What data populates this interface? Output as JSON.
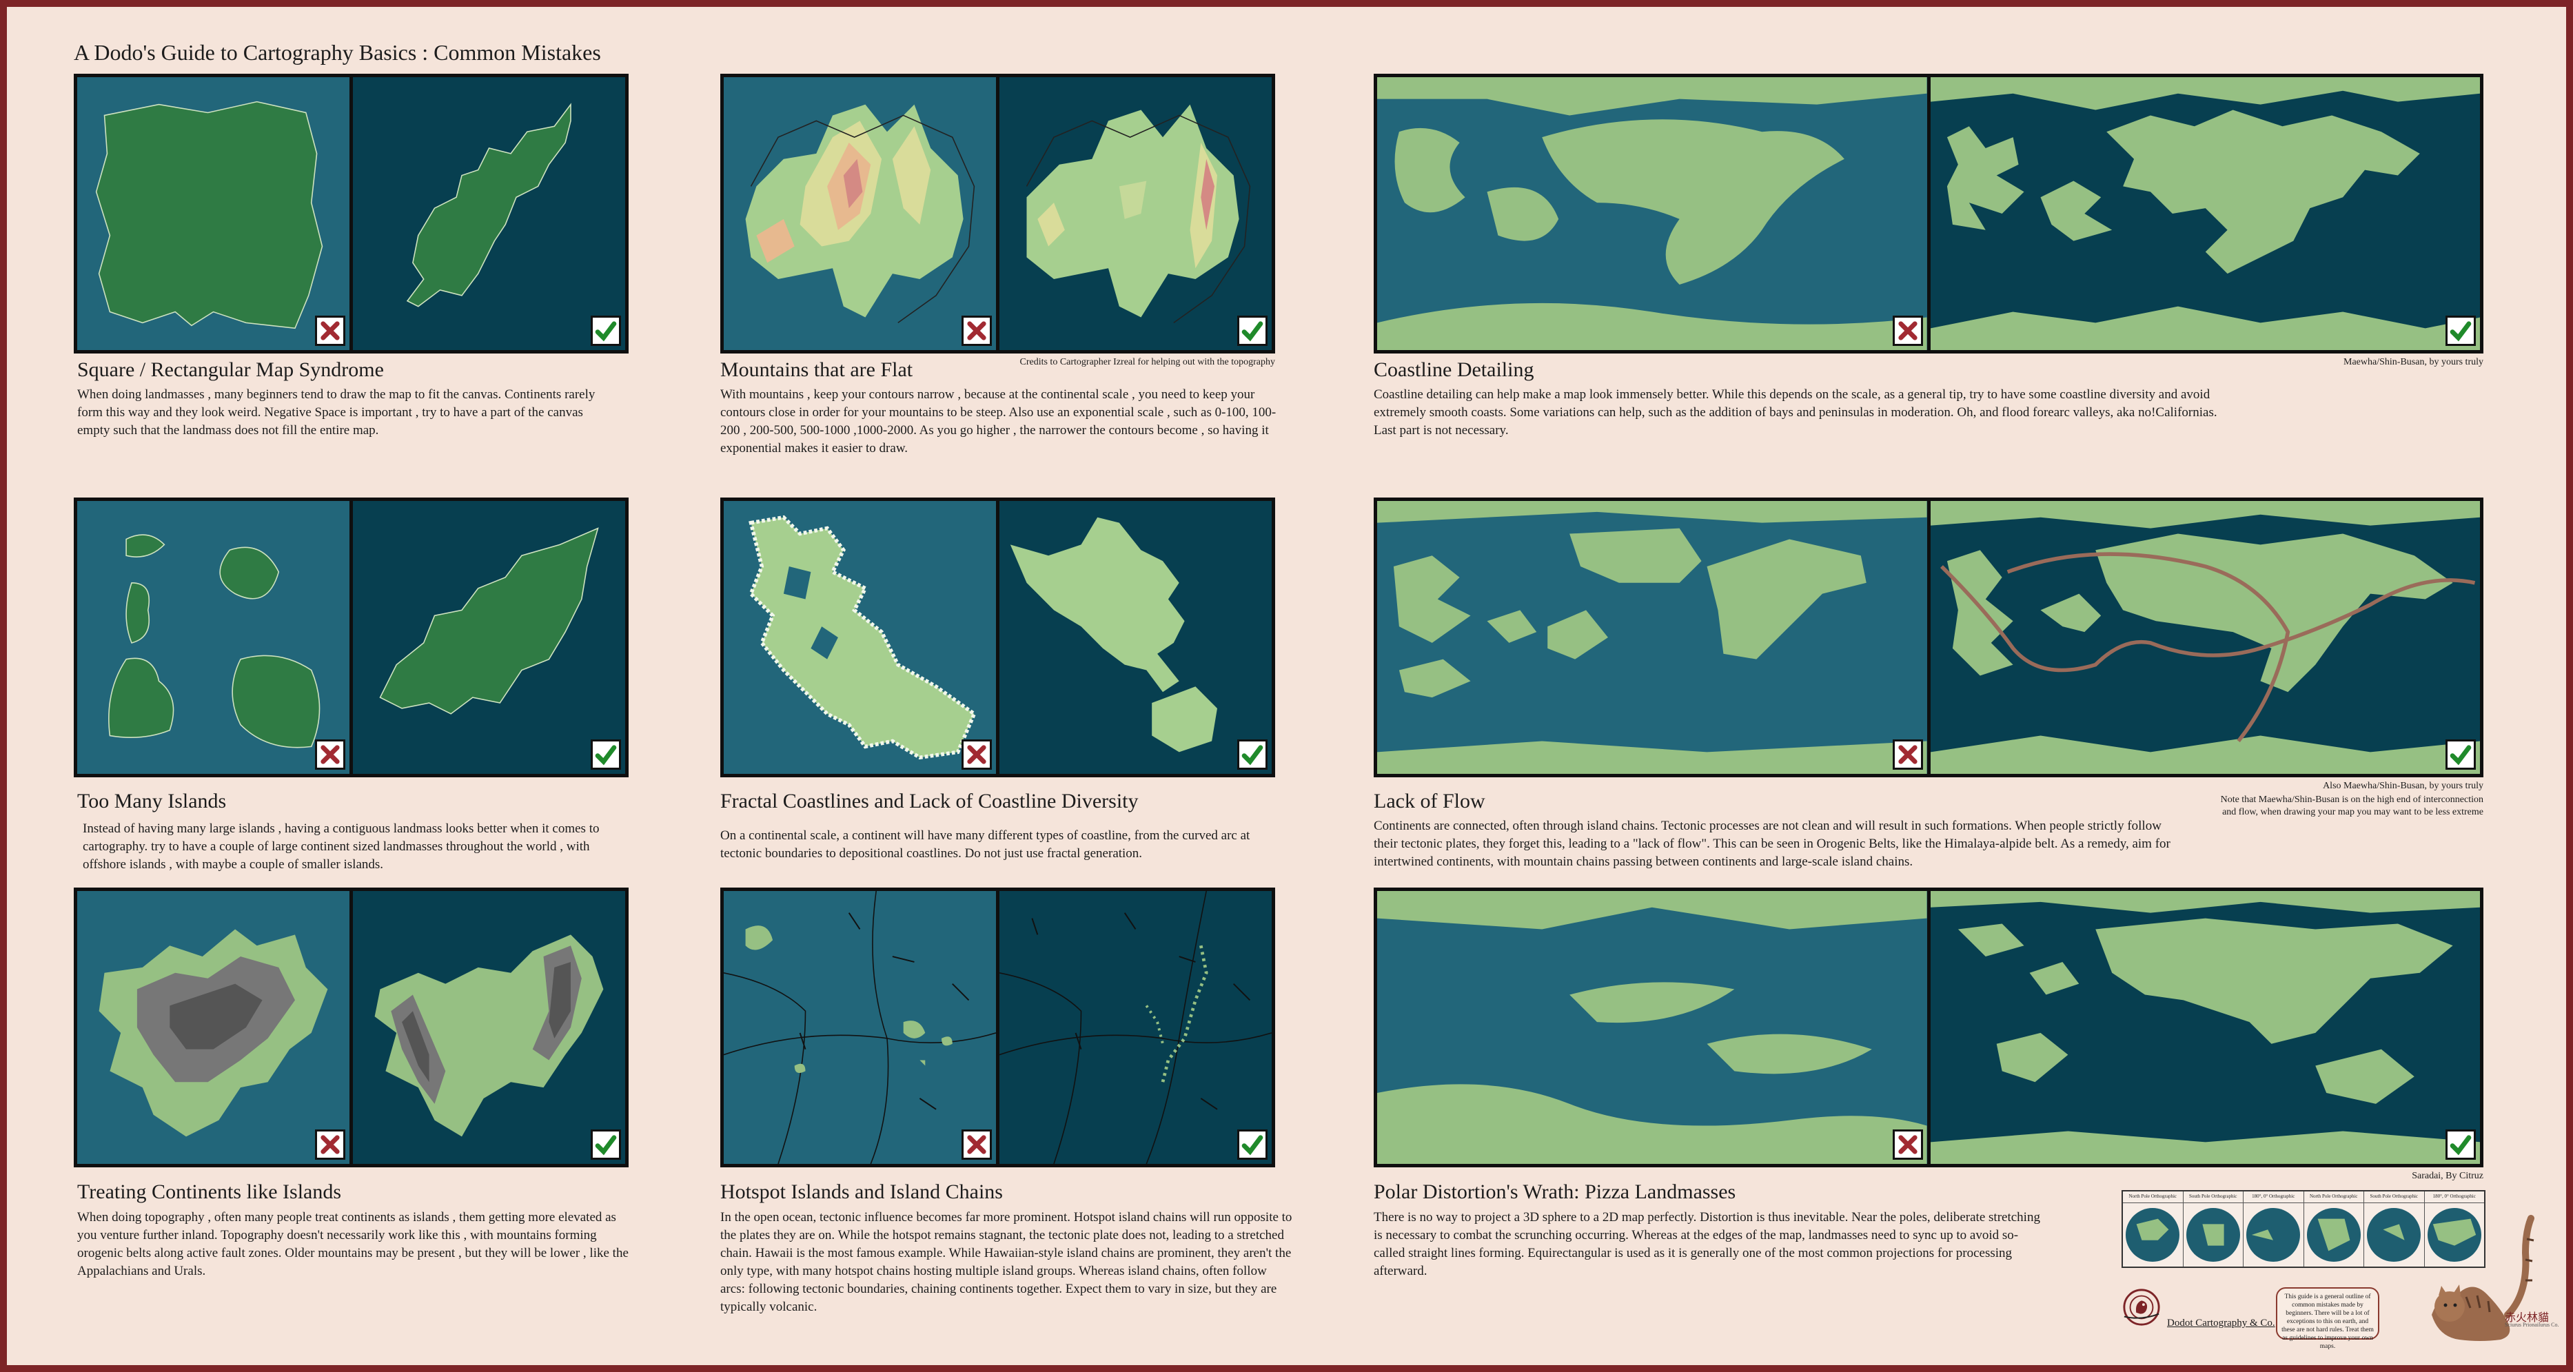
{
  "page_title": "A Dodo's Guide to Cartography Basics : Common Mistakes",
  "colors": {
    "background": "#f5e4da",
    "border": "#7d2427",
    "ocean_light": "#22667a",
    "ocean_dark": "#073f50",
    "land_dark": "#2f7b44",
    "land_light": "#96c083",
    "cross": "#a12a32",
    "check": "#1f8a2a"
  },
  "sections": [
    {
      "title": "Square / Rectangular Map Syndrome",
      "body": "When doing landmasses , many beginners tend to draw the map to fit the canvas. Continents rarely form this way and they look weird. Negative Space is important , try to have a part of the canvas empty such that the landmass does not fill the entire map.",
      "bad_icon": "cross-icon",
      "good_icon": "check-icon"
    },
    {
      "title": "Mountains that are Flat",
      "credit": "Credits to Cartographer Izreal for helping out with the topography",
      "body": "With mountains , keep your contours narrow , because at the continental scale , you need to keep your contours close in order for your mountains to be steep. Also use an exponential scale , such as 0-100, 100-200 , 200-500, 500-1000 ,1000-2000. As you go higher , the narrower the contours become , so having it exponential makes it easier to draw.",
      "bad_icon": "cross-icon",
      "good_icon": "check-icon"
    },
    {
      "title": "Coastline Detailing",
      "credit": "Maewha/Shin-Busan, by yours truly",
      "body": "Coastline detailing can help make a map look immensely better. While this depends on the scale, as a general tip, try to have some coastline diversity and avoid extremely smooth coasts. Some variations can help, such as the addition of bays and peninsulas in moderation. Oh, and flood forearc valleys, aka no!Californias. Last part is not necessary.",
      "bad_icon": "cross-icon",
      "good_icon": "check-icon"
    },
    {
      "title": "Too Many Islands",
      "body": "Instead of having many large islands , having a contiguous landmass looks better when it comes to cartography. try to have a couple of large continent sized landmasses throughout the world , with offshore islands , with maybe a couple of smaller islands.",
      "bad_icon": "cross-icon",
      "good_icon": "check-icon"
    },
    {
      "title": "Fractal Coastlines and Lack of Coastline Diversity",
      "body": "On a continental scale, a continent will have many different types of coastline, from the curved arc at tectonic boundaries to depositional coastlines. Do not just use fractal generation.",
      "bad_icon": "cross-icon",
      "good_icon": "check-icon"
    },
    {
      "title": "Lack of Flow",
      "credit": "Also Maewha/Shin-Busan, by yours truly",
      "credit2": "Note that Maewha/Shin-Busan is on the high end of interconnection and flow, when drawing your map you may want to be less extreme",
      "body": "Continents are connected, often through island chains. Tectonic processes are not clean and will result in such formations. When people strictly follow their tectonic plates, they forget this, leading to a \"lack of flow\". This can be seen in Orogenic Belts, like the Himalaya-alpide belt. As a remedy, aim for intertwined continents, with mountain chains passing between continents and large-scale island chains.",
      "bad_icon": "cross-icon",
      "good_icon": "check-icon"
    },
    {
      "title": "Treating Continents like Islands",
      "body": "When doing topography , often many people treat continents as islands , them getting more elevated as you venture further inland. Topography doesn't necessarily work like this , with mountains forming orogenic belts along active fault zones. Older mountains may be present , but they will be lower , like the Appalachians and Urals.",
      "bad_icon": "cross-icon",
      "good_icon": "check-icon"
    },
    {
      "title": "Hotspot Islands and Island Chains",
      "body": "In the open ocean, tectonic influence becomes far more prominent. Hotspot island chains will run opposite to the plates they are on. While the hotspot remains stagnant, the tectonic plate does not, leading to a stretched chain. Hawaii is the most famous example. While Hawaiian-style island chains are prominent, they aren't the only type, with many hotspot chains hosting multiple island groups. Whereas island chains, often follow arcs: following tectonic boundaries, chaining continents together. Expect them to vary in size, but they are typically volcanic.",
      "bad_icon": "cross-icon",
      "good_icon": "check-icon"
    },
    {
      "title": "Polar Distortion's Wrath: Pizza Landmasses",
      "credit": "Saradai, By Citruz",
      "body": "There is no way to project a 3D sphere to a 2D map perfectly. Distortion is thus inevitable. Near the poles, deliberate stretching is necessary to combat the scrunching occurring. Whereas at the edges of the map, landmasses need to sync up to avoid so-called straight lines forming. Equirectangular is used as it is generally one of the most common projections for processing afterward.",
      "bad_icon": "cross-icon",
      "good_icon": "check-icon"
    }
  ],
  "projections": [
    "North Pole Orthographic",
    "South Pole Orthographic",
    "180°, 0° Orthographic",
    "North Pole Orthographic",
    "South Pole Orthographic",
    "180°, 0° Orthographic"
  ],
  "footer": {
    "brand": "Dodot Cartography & Co.",
    "note": "This guide is a general outline of common mistakes made by beginners. There will be a lot of exceptions to this on earth, and these are not hard rules. Treat them as guidelines to improve your own maps.",
    "signature": "赤火林貓",
    "signature_sub": "Sciurus Prionailurus Co."
  }
}
